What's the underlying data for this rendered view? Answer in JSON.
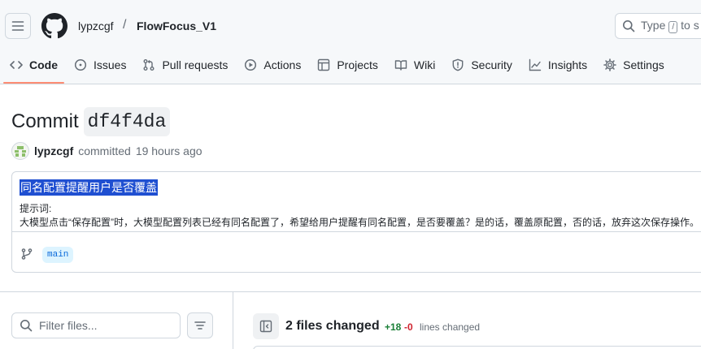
{
  "header": {
    "owner": "lypzcgf",
    "separator": "/",
    "repo": "FlowFocus_V1",
    "search": {
      "prefix": "Type",
      "key": "/",
      "suffix": "to s"
    }
  },
  "tabs": [
    {
      "label": "Code",
      "icon": "code-icon",
      "active": true
    },
    {
      "label": "Issues",
      "icon": "issue-opened-icon"
    },
    {
      "label": "Pull requests",
      "icon": "git-pull-request-icon"
    },
    {
      "label": "Actions",
      "icon": "play-icon"
    },
    {
      "label": "Projects",
      "icon": "table-icon"
    },
    {
      "label": "Wiki",
      "icon": "book-icon"
    },
    {
      "label": "Security",
      "icon": "shield-icon"
    },
    {
      "label": "Insights",
      "icon": "graph-icon"
    },
    {
      "label": "Settings",
      "icon": "gear-icon"
    }
  ],
  "commit": {
    "heading": "Commit",
    "sha": "df4f4da",
    "author": "lypzcgf",
    "action": "committed",
    "time": "19 hours ago",
    "message_title": "同名配置提醒用户是否覆盖",
    "message_body_line1": "提示词:",
    "message_body_line2": "大模型点击“保存配置”时，大模型配置列表已经有同名配置了，希望给用户提醒有同名配置，是否要覆盖？是的话，覆盖原配置，否的话，放弃这次保存操作。",
    "branch": "main"
  },
  "files": {
    "filter_placeholder": "Filter files...",
    "changed_count": "2 files changed",
    "additions": "+18",
    "deletions": "-0",
    "lines_changed": "lines changed"
  },
  "colors": {
    "accent_underline": "#fd8c73",
    "link_blue": "#0969da",
    "addition_green": "#1a7f37",
    "deletion_red": "#cf222e",
    "selection_blue": "#1f4fd1"
  }
}
